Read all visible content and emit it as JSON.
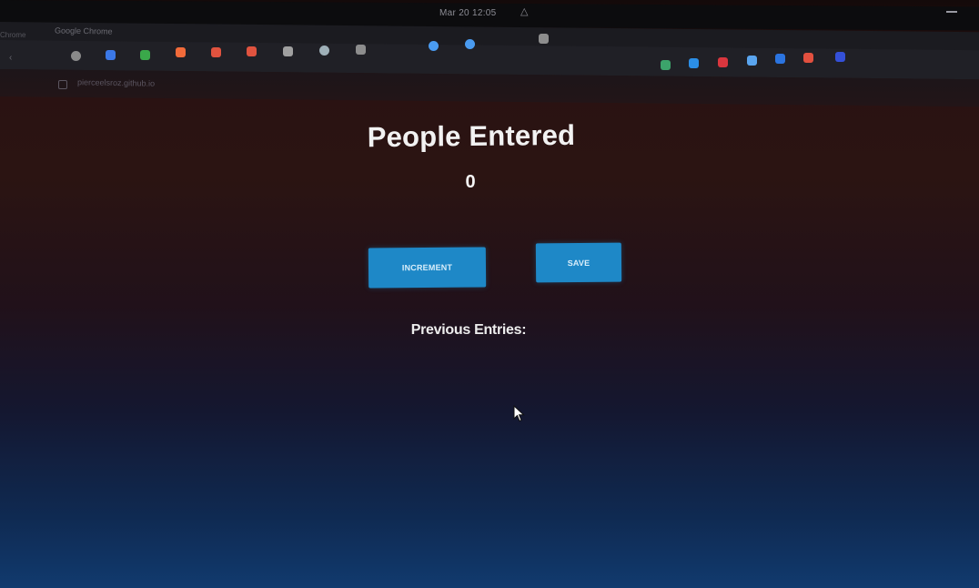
{
  "os": {
    "clock": "Mar 20  12:05",
    "bell_icon": "bell-icon",
    "minimize_icon": "minimize-icon"
  },
  "browser": {
    "tab_title": "Google Chrome",
    "prev_tab": "Chrome",
    "url": "pierceelsroz.github.io",
    "extensions": [
      {
        "name": "chrome-icon",
        "color": "#8a8a8a"
      },
      {
        "name": "docs-icon",
        "color": "#3b78e7"
      },
      {
        "name": "leaf-icon",
        "color": "#3aa84a"
      },
      {
        "name": "slides-icon",
        "color": "#f26b3a"
      },
      {
        "name": "mail-icon",
        "color": "#e0533f"
      },
      {
        "name": "mail-icon",
        "color": "#e0533f"
      },
      {
        "name": "gc-icon",
        "color": "#a0a0a0"
      },
      {
        "name": "globe-icon",
        "color": "#9fb0b8"
      },
      {
        "name": "edit-icon",
        "color": "#8d8d8d"
      },
      {
        "name": "cloud-icon",
        "color": "#4a9bf0"
      },
      {
        "name": "cloud-icon",
        "color": "#4a9bf0"
      },
      {
        "name": "pen-icon",
        "color": "#8d8d8d"
      },
      {
        "name": "rocket-icon",
        "color": "#3ca46b"
      },
      {
        "name": "shield-icon",
        "color": "#2b8ee6"
      },
      {
        "name": "warning-icon",
        "color": "#d9363e"
      },
      {
        "name": "feather-icon",
        "color": "#5aa5ef"
      },
      {
        "name": "e-icon",
        "color": "#2b74e0"
      },
      {
        "name": "a-icon",
        "color": "#e2503f"
      },
      {
        "name": "chat-icon",
        "color": "#3450d8"
      }
    ]
  },
  "main": {
    "title": "People Entered",
    "count": "0",
    "increment_label": "INCREMENT",
    "save_label": "SAVE",
    "previous_entries_label": "Previous Entries:"
  },
  "colors": {
    "button": "#1e88c7",
    "text": "#f2f2f2"
  }
}
